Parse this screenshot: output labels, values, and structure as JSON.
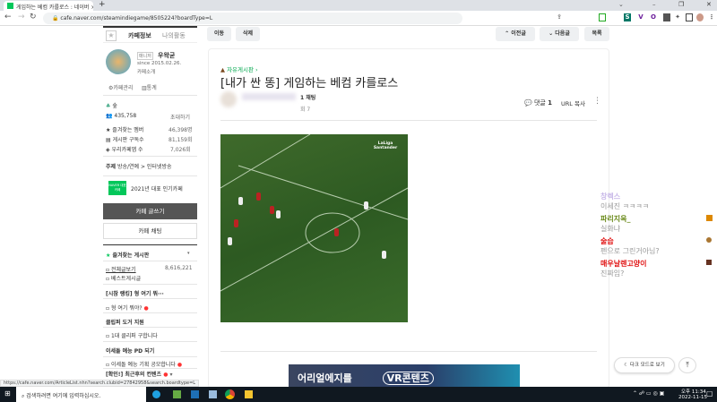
{
  "browser": {
    "tab_title": "게임하는 베컴 카를로스 : 네이버",
    "new_tab": "+",
    "url": "cafe.naver.com/steamindiegame/8505224?boardType=L",
    "window_controls": [
      "⌄",
      "–",
      "❐",
      "✕"
    ]
  },
  "sidebar": {
    "tab_info": "카페정보",
    "tab_activity": "나의활동",
    "manager_badge": "매니저",
    "manager_name": "우왁굳",
    "since": "since 2015.02.26.",
    "cafe_intro": "카페소개",
    "manage_link": "카페관리",
    "stats_link": "통계",
    "level": "숲",
    "members": "435,758",
    "invite": "초대하기",
    "fav_members_label": "즐겨찾는 멤버",
    "fav_members": "46,398명",
    "board_sub_label": "게시판 구독수",
    "board_sub": "81,159회",
    "our_cafe_label": "우리카페앱 수",
    "our_cafe": "7,026회",
    "topic_label": "주제",
    "topic": "방송/연예 > 인터넷방송",
    "award_badge": "NAVER 대표카페",
    "award": "2021년 대표 인기카페",
    "write_button": "카페 글쓰기",
    "chat_button": "카페 채팅",
    "fav_boards": "즐겨찾는 게시판",
    "boards": [
      {
        "label": "전체글보기",
        "count": "8,616,221"
      },
      {
        "label": "베스트게시글"
      }
    ],
    "sections": [
      {
        "title": "[시참 랭킹] 형 여기 뭐···",
        "items": [
          "형 여기 뭐야?"
        ]
      },
      {
        "title": "클립퍼 도거 지원",
        "items": [
          "1대 클리퍼 구합니다"
        ]
      },
      {
        "title": "이세돌 예능 PD 되기",
        "items": [
          "이세돌 예능 기획 공모합니다"
        ]
      },
      {
        "title": "[확인!] 최근후의 컨텐츠"
      }
    ]
  },
  "toolbar": {
    "move": "이동",
    "delete": "삭제",
    "prev": "이전글",
    "next": "다음글",
    "list": "목록"
  },
  "article": {
    "board": "자유게시판",
    "title": "[내가 싼 똥] 게임하는 베컴 카를로스",
    "author_suffix": "1 채팅",
    "views": "회 7",
    "comments_label": "댓글",
    "comments": "1",
    "url_copy": "URL 복사",
    "video_logo": "LaLiga Santander"
  },
  "ad": {
    "text": "어리얼에지를",
    "vr": "VR콘텐츠"
  },
  "chat": [
    {
      "name": "창렉스",
      "msg": "이세진 ㅋㅋㅋㅋ",
      "color": "#c8b8e8"
    },
    {
      "name": "파리지옥_",
      "msg": "실화냐",
      "color": "#6a8a1a"
    },
    {
      "name": "술습",
      "msg": "펜으로 그린거아님?",
      "color": "#e01010"
    },
    {
      "name": "매우날렌고양이",
      "msg": "진짜임?",
      "color": "#e01010"
    }
  ],
  "floating": {
    "dark_mode": "다크 모드로 보기",
    "top": "⤒"
  },
  "status_url": "https://cafe.naver.com/ArticleList.nhn?search.clubid=27842958&search.boardtype=L",
  "taskbar": {
    "search": "검색하려면 여기에 입력하십시오.",
    "time": "오후 11:34",
    "date": "2022-11-15"
  }
}
